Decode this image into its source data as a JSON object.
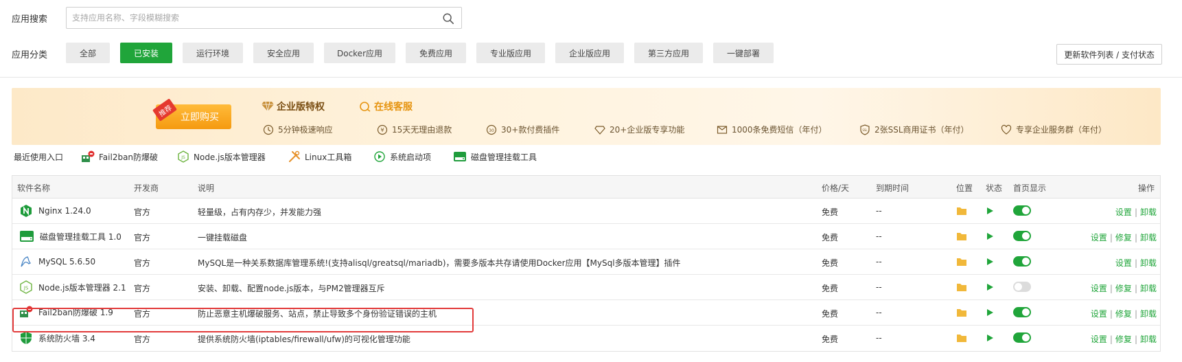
{
  "search": {
    "label": "应用搜索",
    "placeholder": "支持应用名称、字段模糊搜索"
  },
  "category": {
    "label": "应用分类",
    "items": [
      "全部",
      "已安装",
      "运行环境",
      "安全应用",
      "Docker应用",
      "免费应用",
      "专业版应用",
      "企业版应用",
      "第三方应用",
      "一键部署"
    ],
    "active_index": 1,
    "update_label": "更新软件列表 / 支付状态"
  },
  "banner": {
    "tag": "推荐",
    "buy_label": "立即购买",
    "title": "企业版特权",
    "service": "在线客服",
    "features": [
      "5分钟极速响应",
      "15天无理由退款",
      "30+款付费插件",
      "20+企业版专享功能",
      "1000条免费短信（年付）",
      "2张SSL商用证书（年付）",
      "专享企业服务群（年付）"
    ]
  },
  "recent": {
    "label": "最近使用入口",
    "items": [
      "Fail2ban防爆破",
      "Node.js版本管理器",
      "Linux工具箱",
      "系统启动项",
      "磁盘管理挂载工具"
    ]
  },
  "table": {
    "headers": [
      "软件名称",
      "开发商",
      "说明",
      "价格/天",
      "到期时间",
      "位置",
      "状态",
      "首页显示",
      "操作"
    ],
    "rows": [
      {
        "name": "Nginx 1.24.0",
        "vendor": "官方",
        "desc": "轻量级，占有内存少，并发能力强",
        "price": "免费",
        "expire": "--",
        "home": true,
        "ops": [
          "设置",
          "卸载"
        ],
        "icon": "nginx-icon"
      },
      {
        "name": "磁盘管理挂载工具 1.0",
        "vendor": "官方",
        "desc": "一键挂载磁盘",
        "price": "免费",
        "expire": "--",
        "home": true,
        "ops": [
          "设置",
          "修复",
          "卸载"
        ],
        "icon": "disk-icon"
      },
      {
        "name": "MySQL 5.6.50",
        "vendor": "官方",
        "desc": "MySQL是一种关系数据库管理系统!(支持alisql/greatsql/mariadb)，需要多版本共存请使用Docker应用【MySql多版本管理】插件",
        "price": "免费",
        "expire": "--",
        "home": true,
        "ops": [
          "设置",
          "卸载"
        ],
        "icon": "mysql-icon"
      },
      {
        "name": "Node.js版本管理器 2.1",
        "vendor": "官方",
        "desc": "安装、卸载、配置node.js版本，与PM2管理器互斥",
        "price": "免费",
        "expire": "--",
        "home": false,
        "ops": [
          "设置",
          "修复",
          "卸载"
        ],
        "icon": "nodejs-icon"
      },
      {
        "name": "Fail2ban防爆破 1.9",
        "vendor": "官方",
        "desc": "防止恶意主机爆破服务、站点，禁止导致多个身份验证错误的主机",
        "price": "免费",
        "expire": "--",
        "home": true,
        "ops": [
          "设置",
          "修复",
          "卸载"
        ],
        "icon": "fail2ban-icon"
      },
      {
        "name": "系统防火墙 3.4",
        "vendor": "官方",
        "desc": "提供系统防火墙(iptables/firewall/ufw)的可视化管理功能",
        "price": "免费",
        "expire": "--",
        "home": true,
        "ops": [
          "设置",
          "修复",
          "卸载"
        ],
        "icon": "firewall-icon"
      }
    ]
  },
  "colors": {
    "accent": "#20a53a",
    "highlight": "#e23a3a"
  }
}
